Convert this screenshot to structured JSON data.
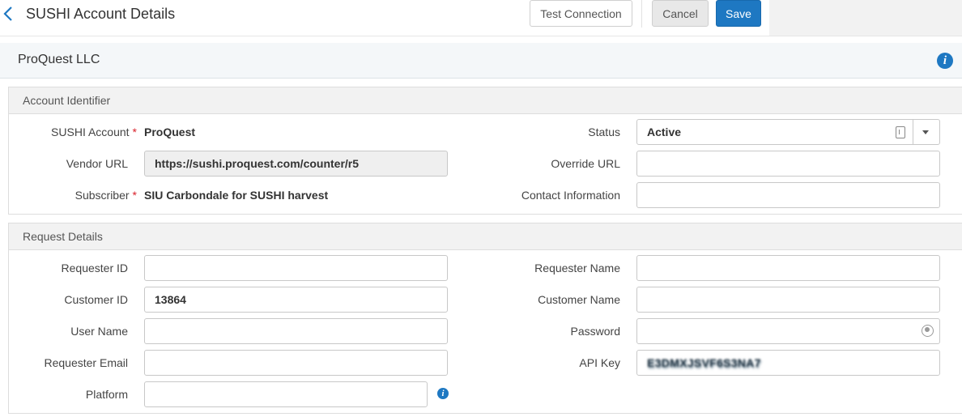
{
  "header": {
    "title": "SUSHI Account Details",
    "test_connection_label": "Test Connection",
    "cancel_label": "Cancel",
    "save_label": "Save",
    "back_icon": "chevron-left-icon"
  },
  "vendor": {
    "name": "ProQuest LLC",
    "info_icon": "info-icon"
  },
  "account_identifier": {
    "title": "Account Identifier",
    "sushi_account_label": "SUSHI Account",
    "sushi_account_value": "ProQuest",
    "vendor_url_label": "Vendor URL",
    "vendor_url_value": "https://sushi.proquest.com/counter/r5",
    "subscriber_label": "Subscriber",
    "subscriber_value": "SIU Carbondale for SUSHI harvest",
    "status_label": "Status",
    "status_value": "Active",
    "override_url_label": "Override URL",
    "override_url_value": "",
    "contact_label": "Contact Information",
    "contact_value": "",
    "required_mark": "*"
  },
  "request_details": {
    "title": "Request Details",
    "requester_id_label": "Requester ID",
    "requester_id_value": "",
    "customer_id_label": "Customer ID",
    "customer_id_value": "13864",
    "user_name_label": "User Name",
    "user_name_value": "",
    "requester_email_label": "Requester Email",
    "requester_email_value": "",
    "platform_label": "Platform",
    "platform_value": "",
    "requester_name_label": "Requester Name",
    "requester_name_value": "",
    "customer_name_label": "Customer Name",
    "customer_name_value": "",
    "password_label": "Password",
    "password_value": "",
    "api_key_label": "API Key",
    "api_key_value": "E3DMXJSVF6S3NA7"
  },
  "colors": {
    "primary": "#1e78c2",
    "required": "#d9202a",
    "section_header_bg": "#f2f2f2"
  }
}
